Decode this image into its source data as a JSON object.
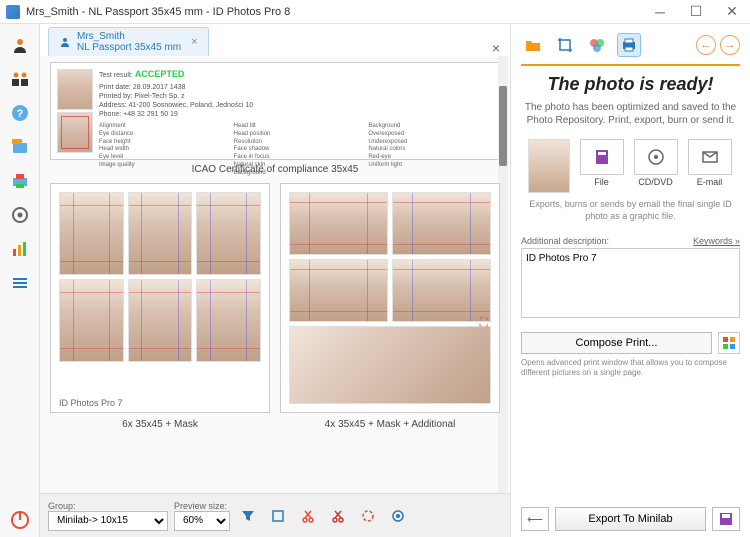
{
  "window": {
    "title": "Mrs_Smith - NL Passport 35x45 mm - ID Photos Pro 8"
  },
  "tab": {
    "line1": "Mrs_Smith",
    "line2": "NL Passport 35x45 mm"
  },
  "certificate": {
    "result_label": "Test result:",
    "result_value": "ACCEPTED",
    "print_date_label": "Print date:",
    "print_date": "28.09.2017 1438",
    "printed_by_label": "Printed by:",
    "printed_by": "Pixel-Tech Sp. z",
    "address_label": "Address:",
    "address": "41-200 Sosnowiec, Poland, Jedności 10",
    "phone_label": "Phone:",
    "phone": "+48 32 291 50 19",
    "caption": "ICAO Certificate of compliance 35x45"
  },
  "layouts": {
    "left": {
      "sheet_caption": "ID Photos Pro 7",
      "label": "6x 35x45 + Mask"
    },
    "right": {
      "label": "4x 35x45 + Mask + Additional"
    }
  },
  "bottombar": {
    "group_label": "Group:",
    "group_value": "Minilab-> 10x15",
    "preview_label": "Preview size:",
    "preview_value": "60%"
  },
  "rightpanel": {
    "title": "The photo is ready!",
    "subtitle": "The photo has been optimized and saved to the Photo Repository. Print, export, burn or send it.",
    "actions": {
      "file": "File",
      "cddvd": "CD/DVD",
      "email": "E-mail"
    },
    "actions_hint": "Exports, burns or sends by email the final single ID photo as a graphic file.",
    "desc_label": "Additional description:",
    "keywords": "Keywords »",
    "desc_value": "ID Photos Pro 7",
    "compose": "Compose Print...",
    "compose_hint": "Opens advanced print window that allows you to compose different pictures on a single page.",
    "export": "Export To Minilab"
  }
}
